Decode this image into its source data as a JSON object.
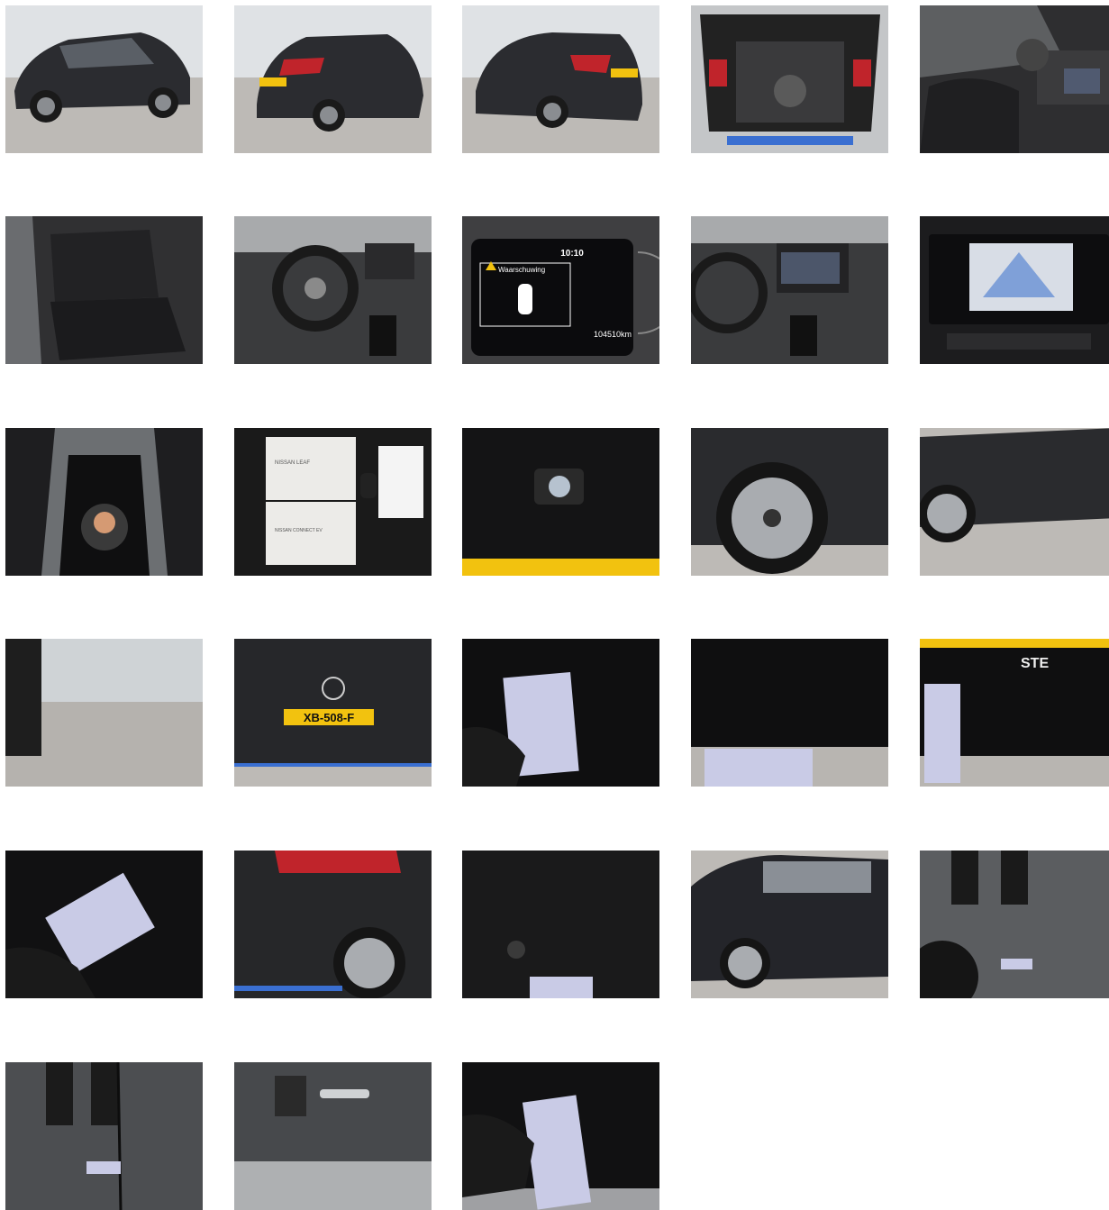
{
  "gallery": {
    "photos": [
      {
        "kind": "exterior-front-left"
      },
      {
        "kind": "exterior-rear-left"
      },
      {
        "kind": "exterior-rear-right"
      },
      {
        "kind": "open-trunk"
      },
      {
        "kind": "front-interior"
      },
      {
        "kind": "rear-seats"
      },
      {
        "kind": "dashboard-steering-wheel"
      },
      {
        "kind": "instrument-cluster",
        "time": "10:10",
        "warning": "Waarschuwing",
        "odometer": "104510km"
      },
      {
        "kind": "dashboard-center"
      },
      {
        "kind": "infotainment-screen"
      },
      {
        "kind": "center-console-shifter"
      },
      {
        "kind": "manuals-and-keys",
        "manual_title": "NISSAN LEAF",
        "manual_title_2": "NISSAN CONNECT EV"
      },
      {
        "kind": "rear-camera"
      },
      {
        "kind": "rear-wheel-closeup"
      },
      {
        "kind": "side-wheel-closeup"
      },
      {
        "kind": "ground-reflection"
      },
      {
        "kind": "rear-license-plate",
        "plate": "XB-508-F"
      },
      {
        "kind": "damage-measure-1"
      },
      {
        "kind": "damage-measure-2"
      },
      {
        "kind": "damage-measure-3",
        "lettering": "STE"
      },
      {
        "kind": "damage-measure-4"
      },
      {
        "kind": "rear-quarter-damage"
      },
      {
        "kind": "damage-measure-5"
      },
      {
        "kind": "side-profile"
      },
      {
        "kind": "scratch-closeup"
      },
      {
        "kind": "door-seam-measure"
      },
      {
        "kind": "door-handle-reflection"
      },
      {
        "kind": "damage-measure-6"
      }
    ],
    "colors": {
      "car_body": "#2a2b2e",
      "floor": "#b7b5b2",
      "wall": "#dcdfe2",
      "interior": "#2e2e30",
      "card": "#c9cbe6",
      "plate": "#f2c20f",
      "tail_light": "#c0242b"
    }
  }
}
